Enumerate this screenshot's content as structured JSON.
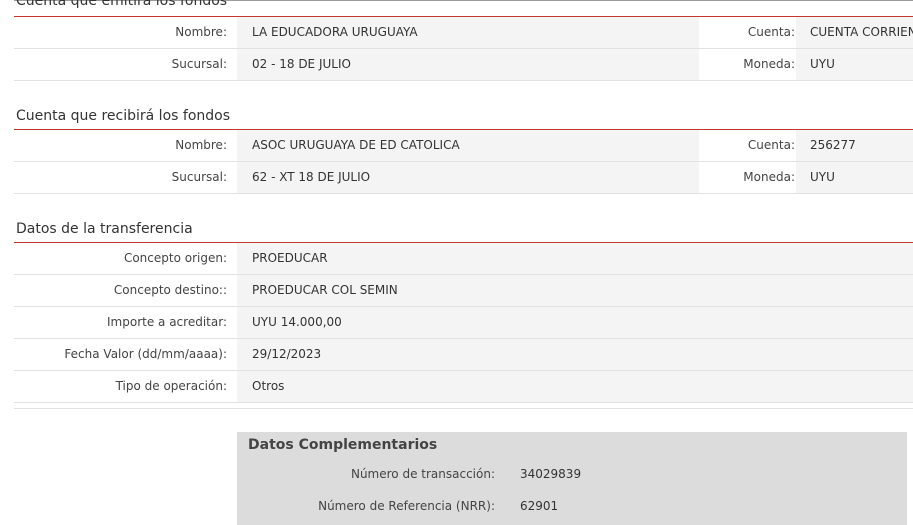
{
  "origin": {
    "title": "Cuenta que emitirá los fondos",
    "nombre_label": "Nombre:",
    "nombre_value": "LA EDUCADORA URUGUAYA",
    "cuenta_label": "Cuenta:",
    "cuenta_value": "CUENTA CORRIEN",
    "sucursal_label": "Sucursal:",
    "sucursal_value": "02 - 18 DE JULIO",
    "moneda_label": "Moneda:",
    "moneda_value": "UYU"
  },
  "destination": {
    "title": "Cuenta que recibirá los fondos",
    "nombre_label": "Nombre:",
    "nombre_value": "ASOC URUGUAYA DE ED CATOLICA",
    "cuenta_label": "Cuenta:",
    "cuenta_value": "256277",
    "sucursal_label": "Sucursal:",
    "sucursal_value": "62 - XT 18 DE JULIO",
    "moneda_label": "Moneda:",
    "moneda_value": "UYU"
  },
  "transfer": {
    "title": "Datos de la transferencia",
    "rows": [
      {
        "label": "Concepto origen:",
        "value": "PROEDUCAR"
      },
      {
        "label": "Concepto destino::",
        "value": "PROEDUCAR COL SEMIN"
      },
      {
        "label": "Importe a acreditar:",
        "value": "UYU 14.000,00"
      },
      {
        "label": "Fecha Valor (dd/mm/aaaa):",
        "value": "29/12/2023"
      },
      {
        "label": "Tipo de operación:",
        "value": "Otros"
      }
    ]
  },
  "complementary": {
    "title": "Datos Complementarios",
    "transaction_label": "Número de transacción:",
    "transaction_value": "34029839",
    "reference_label": "Número de Referencia (NRR):",
    "reference_value": "62901"
  }
}
